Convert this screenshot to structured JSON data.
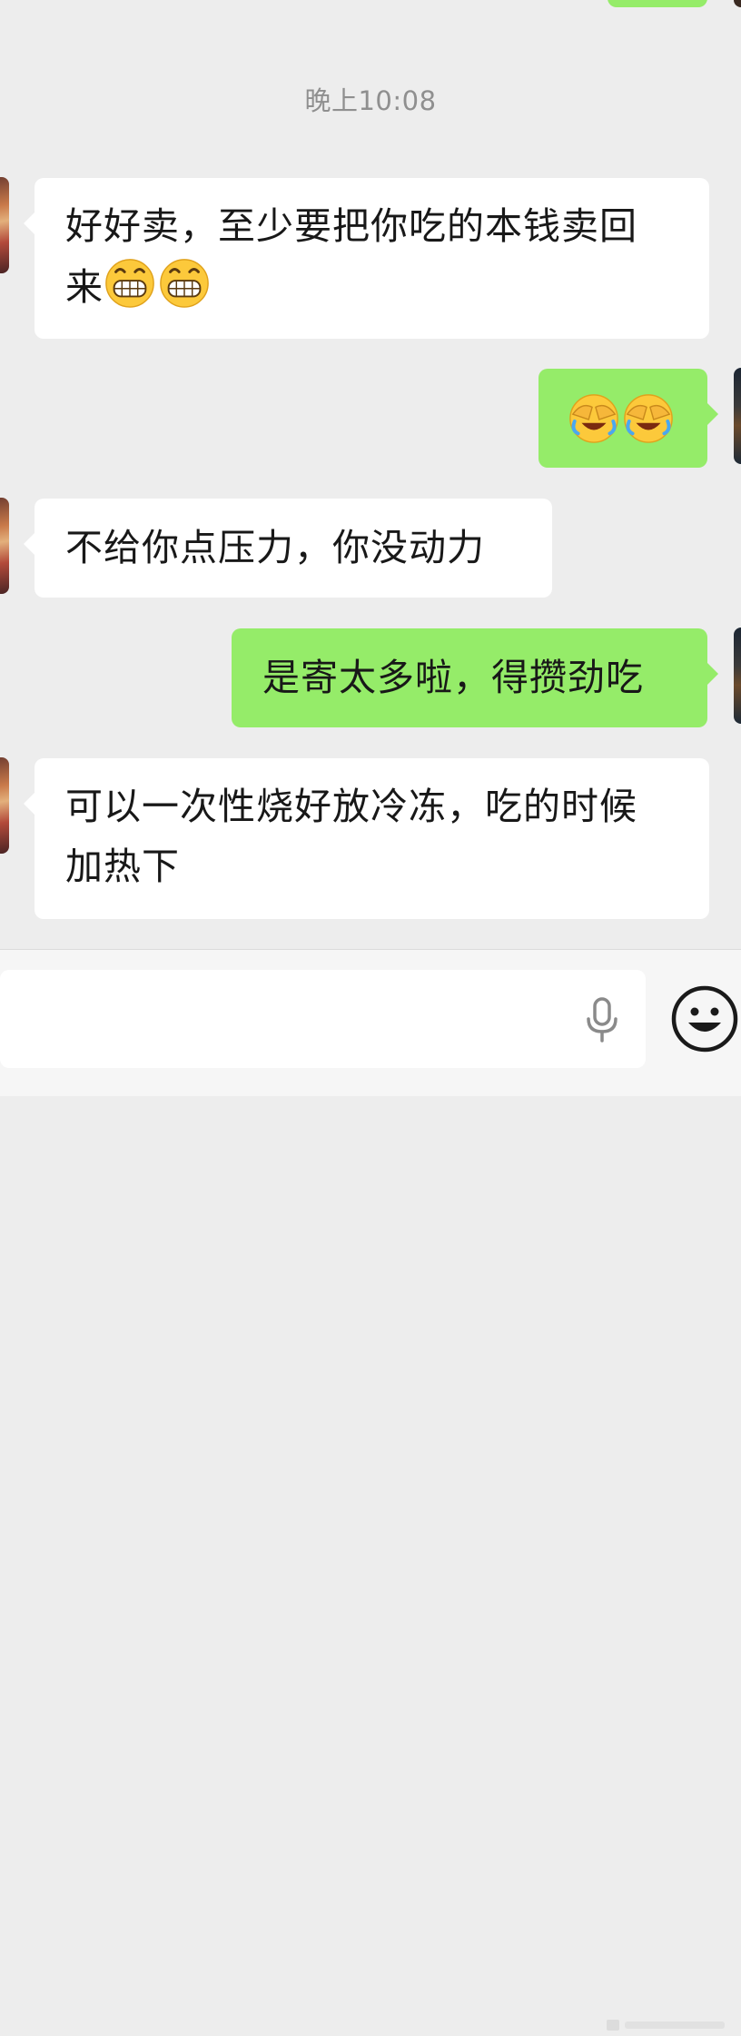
{
  "timestamp": "晚上10:08",
  "messages": [
    {
      "direction": "in",
      "text_line1": "好好卖，至少要把你吃的本钱卖回",
      "text_line2": "来",
      "emoji": [
        "grinning-face",
        "grinning-face"
      ]
    },
    {
      "direction": "out",
      "emoji": [
        "laughing-crying-face",
        "laughing-crying-face"
      ]
    },
    {
      "direction": "in",
      "text": "不给你点压力，你没动力"
    },
    {
      "direction": "out",
      "text": "是寄太多啦，得攒劲吃"
    },
    {
      "direction": "in",
      "text_line1": "可以一次性烧好放冷冻，吃的时候",
      "text_line2": "加热下"
    }
  ],
  "input": {
    "value": "",
    "mic_icon": "microphone-icon",
    "emoji_button_icon": "smiley-face-icon"
  },
  "colors": {
    "background": "#ededed",
    "incoming_bubble": "#ffffff",
    "outgoing_bubble": "#95ec69",
    "timestamp_text": "#8f8f8f"
  }
}
